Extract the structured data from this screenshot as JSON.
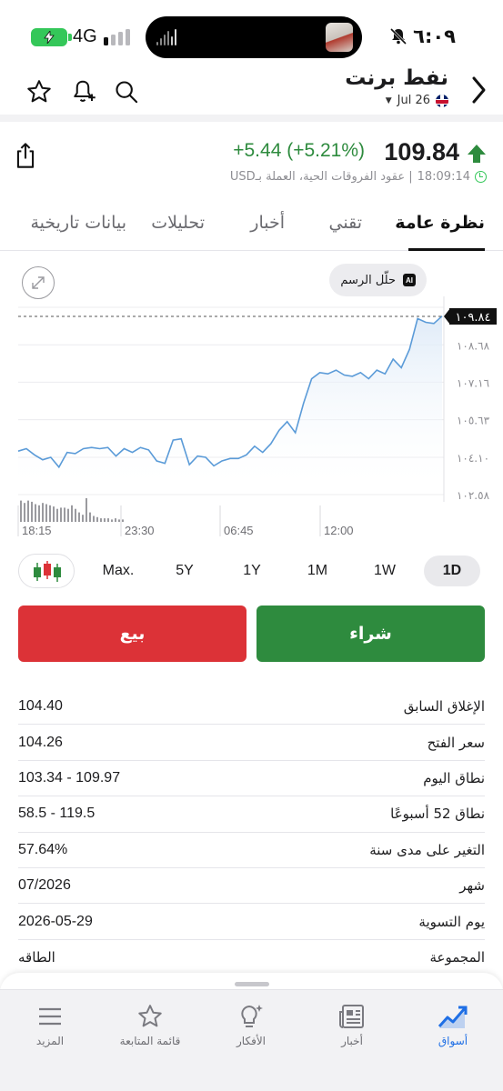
{
  "status_bar": {
    "time": "٦:٠٩",
    "network": "4G",
    "icons": [
      "battery-charging-icon",
      "signal-icon",
      "bell-off-icon"
    ]
  },
  "header": {
    "title": "نفط برنت",
    "contract": "Jul 26",
    "icons": [
      "back-chevron-icon",
      "search-icon",
      "bell-add-icon",
      "star-icon",
      "uk-flag-icon"
    ]
  },
  "quote": {
    "price": "109.84",
    "change": "+5.44 (+5.21%)",
    "timestamp": "18:09:14",
    "description": "| عقود الفروقات الحية، العملة بـUSD",
    "direction_color": "#2e8b3e"
  },
  "tabs": [
    {
      "label": "نظرة عامة",
      "active": true
    },
    {
      "label": "تقني",
      "active": false
    },
    {
      "label": "أخبار",
      "active": false
    },
    {
      "label": "تحليلات",
      "active": false
    },
    {
      "label": "بيانات تاريخية",
      "active": false
    }
  ],
  "chart_actions": {
    "analyze_label": "حلّل الرسم",
    "ai_badge": "AI"
  },
  "chart_data": {
    "type": "area",
    "x_ticks": [
      "18:15",
      "23:30",
      "06:45",
      "12:00"
    ],
    "y_ticks": [
      "١٠٩.٨٤",
      "١٠٨.٦٨",
      "١٠٧.١٦",
      "١٠٥.٦٣",
      "١٠٤.١٠",
      "١٠٢.٥٨"
    ],
    "ylim": [
      102.58,
      110.21
    ],
    "current_value": 109.84,
    "current_label": "١٠٩.٨٤",
    "values": [
      104.35,
      104.45,
      104.2,
      104.0,
      104.1,
      103.7,
      104.3,
      104.25,
      104.45,
      104.5,
      104.45,
      104.5,
      104.15,
      104.45,
      104.3,
      104.5,
      104.4,
      103.95,
      103.85,
      104.8,
      104.85,
      103.8,
      104.15,
      104.1,
      103.75,
      103.95,
      104.05,
      104.05,
      104.2,
      104.55,
      104.3,
      104.65,
      105.2,
      105.55,
      105.1,
      106.3,
      107.3,
      107.55,
      107.5,
      107.65,
      107.45,
      107.4,
      107.55,
      107.3,
      107.65,
      107.5,
      108.1,
      107.75,
      108.5,
      109.75,
      109.6,
      109.55,
      109.85
    ],
    "volume": [
      0.9,
      0.8,
      0.9,
      0.85,
      0.75,
      0.7,
      0.8,
      0.75,
      0.7,
      0.65,
      0.55,
      0.6,
      0.6,
      0.55,
      0.7,
      0.55,
      0.4,
      0.3,
      1.0,
      0.4,
      0.25,
      0.2,
      0.15,
      0.15,
      0.15,
      0.1,
      0.15,
      0.1,
      0.1
    ],
    "line_color": "#5b9bd8",
    "grid": true
  },
  "ranges": [
    {
      "label": "Max.",
      "active": false
    },
    {
      "label": "5Y",
      "active": false
    },
    {
      "label": "1Y",
      "active": false
    },
    {
      "label": "1M",
      "active": false
    },
    {
      "label": "1W",
      "active": false
    },
    {
      "label": "1D",
      "active": true
    }
  ],
  "actions": {
    "sell_label": "بيع",
    "buy_label": "شراء",
    "sell_color": "#dc3237",
    "buy_color": "#2e8b3e"
  },
  "stats": [
    {
      "label": "الإغلاق السابق",
      "value": "104.40"
    },
    {
      "label": "سعر الفتح",
      "value": "104.26"
    },
    {
      "label": "نطاق اليوم",
      "value": "103.34 - 109.97"
    },
    {
      "label": "نطاق 52 أسبوعًا",
      "value": "58.5 - 119.5"
    },
    {
      "label": "التغير على مدى سنة",
      "value": "57.64%"
    },
    {
      "label": "شهر",
      "value": "07/2026"
    },
    {
      "label": "يوم التسوية",
      "value": "2026-05-29"
    },
    {
      "label": "المجموعة",
      "value": "الطاقه"
    }
  ],
  "bottom_nav": [
    {
      "label": "أسواق",
      "icon": "markets-chart-icon",
      "active": true
    },
    {
      "label": "أخبار",
      "icon": "news-icon",
      "active": false
    },
    {
      "label": "الأفكار",
      "icon": "ideas-bulb-icon",
      "active": false
    },
    {
      "label": "قائمة المتابعة",
      "icon": "watchlist-star-icon",
      "active": false
    },
    {
      "label": "المزيد",
      "icon": "more-menu-icon",
      "active": false
    }
  ],
  "accent_color": "#1f6fe5"
}
